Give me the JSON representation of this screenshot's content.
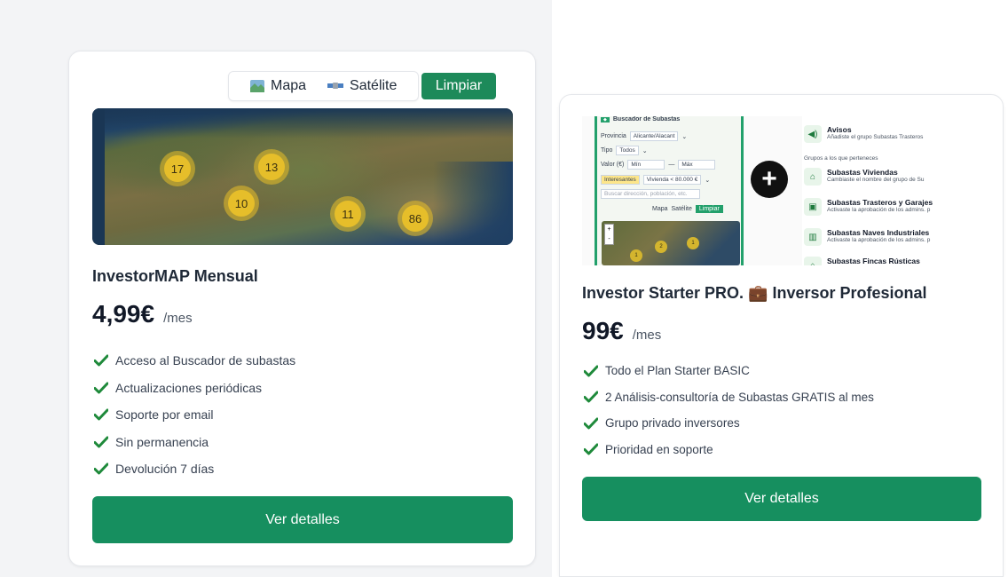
{
  "cards": [
    {
      "map_toolbar": {
        "mapa_label": "Mapa",
        "satelite_label": "Satélite",
        "limpiar_label": "Limpiar"
      },
      "map_clusters": [
        "17",
        "13",
        "10",
        "11",
        "86"
      ],
      "title": "InvestorMAP Mensual",
      "price": "4,99€",
      "period": "/mes",
      "features": [
        "Acceso al Buscador de subastas",
        "Actualizaciones periódicas",
        "Soporte por email",
        "Sin permanencia",
        "Devolución 7 días"
      ],
      "cta": "Ver detalles"
    },
    {
      "preview": {
        "panel_header": "Buscador de Subastas",
        "provincia_label": "Provincia",
        "provincia_value": "Alicante/Alacant",
        "tipo_label": "Tipo",
        "tipo_value": "Todos",
        "valor_label": "Valor (€)",
        "min_placeholder": "Mín",
        "max_placeholder": "Máx",
        "interesantes_label": "Interesantes",
        "vivienda_value": "Vivienda < 80.000 €",
        "search_placeholder": "Buscar dirección, población, etc.",
        "mapa_label": "Mapa",
        "satelite_label": "Satélite",
        "limpiar_label": "Limpiar",
        "mini_clusters": [
          "1",
          "2",
          "1"
        ],
        "avisos_title": "Avisos",
        "avisos_sub": "Añadiste el grupo Subastas Trasteros",
        "grupos_label": "Grupos a los que perteneces",
        "groups": [
          {
            "title": "Subastas Viviendas",
            "sub": "Cambiaste el nombre del grupo de Su"
          },
          {
            "title": "Subastas Trasteros y Garajes",
            "sub": "Activaste la aprobación de los admins. p"
          },
          {
            "title": "Subastas Naves Industriales",
            "sub": "Activaste la aprobación de los admins. p"
          },
          {
            "title": "Subastas Fincas Rústicas",
            "sub": ""
          }
        ]
      },
      "title": "Investor Starter PRO. 💼 Inversor Profesional",
      "price": "99€",
      "period": "/mes",
      "features": [
        "Todo el Plan Starter BASIC",
        "2 Análisis-consultoría de Subastas GRATIS al mes",
        "Grupo privado inversores",
        "Prioridad en soporte"
      ],
      "cta": "Ver detalles"
    }
  ],
  "colors": {
    "accent": "#168f5f",
    "check": "#1f8a3b",
    "cluster": "#e6be2a"
  },
  "icons": {
    "mapa": "map-icon",
    "satelite": "satellite-icon",
    "check": "check-icon",
    "plus": "plus-icon"
  }
}
